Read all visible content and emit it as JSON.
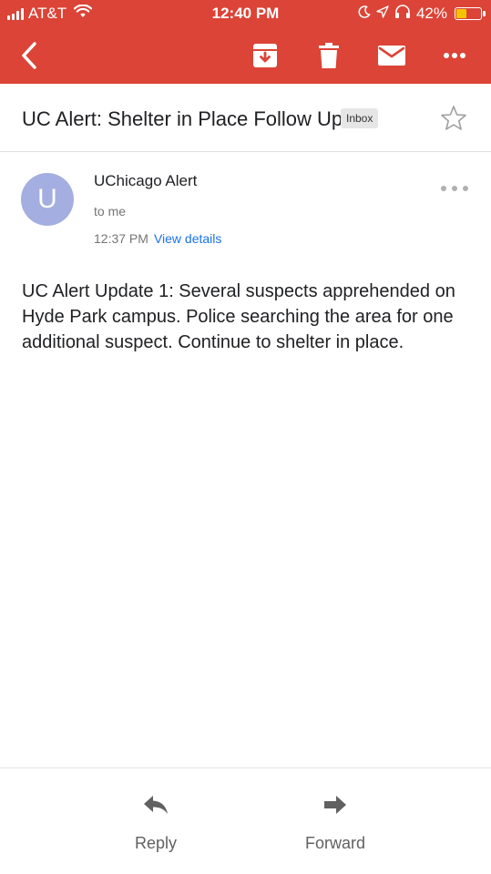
{
  "status_bar": {
    "carrier": "AT&T",
    "time": "12:40 PM",
    "battery": "42%",
    "battery_level": 0.42,
    "icons": [
      "signal-icon",
      "wifi-icon",
      "moon-icon",
      "location-icon",
      "headphones-icon",
      "battery-icon"
    ]
  },
  "toolbar": {
    "icons": [
      "back-arrow-icon",
      "archive-icon",
      "trash-icon",
      "mail-icon",
      "more-icon"
    ]
  },
  "email": {
    "subject": "UC Alert: Shelter in Place Follow Up",
    "label": "Inbox",
    "sender_initial": "U",
    "sender_name": "UChicago Alert",
    "recipient": "to me",
    "time": "12:37 PM",
    "details_link": "View details",
    "body": "UC Alert Update 1: Several suspects apprehended on Hyde Park campus. Police searching the area for one additional suspect. Continue to shelter in place."
  },
  "actions": {
    "reply_label": "Reply",
    "forward_label": "Forward"
  },
  "colors": {
    "header": "#db4437",
    "avatar": "#a4aee0",
    "link": "#1a73e8",
    "battery_fill": "#f5c400"
  }
}
